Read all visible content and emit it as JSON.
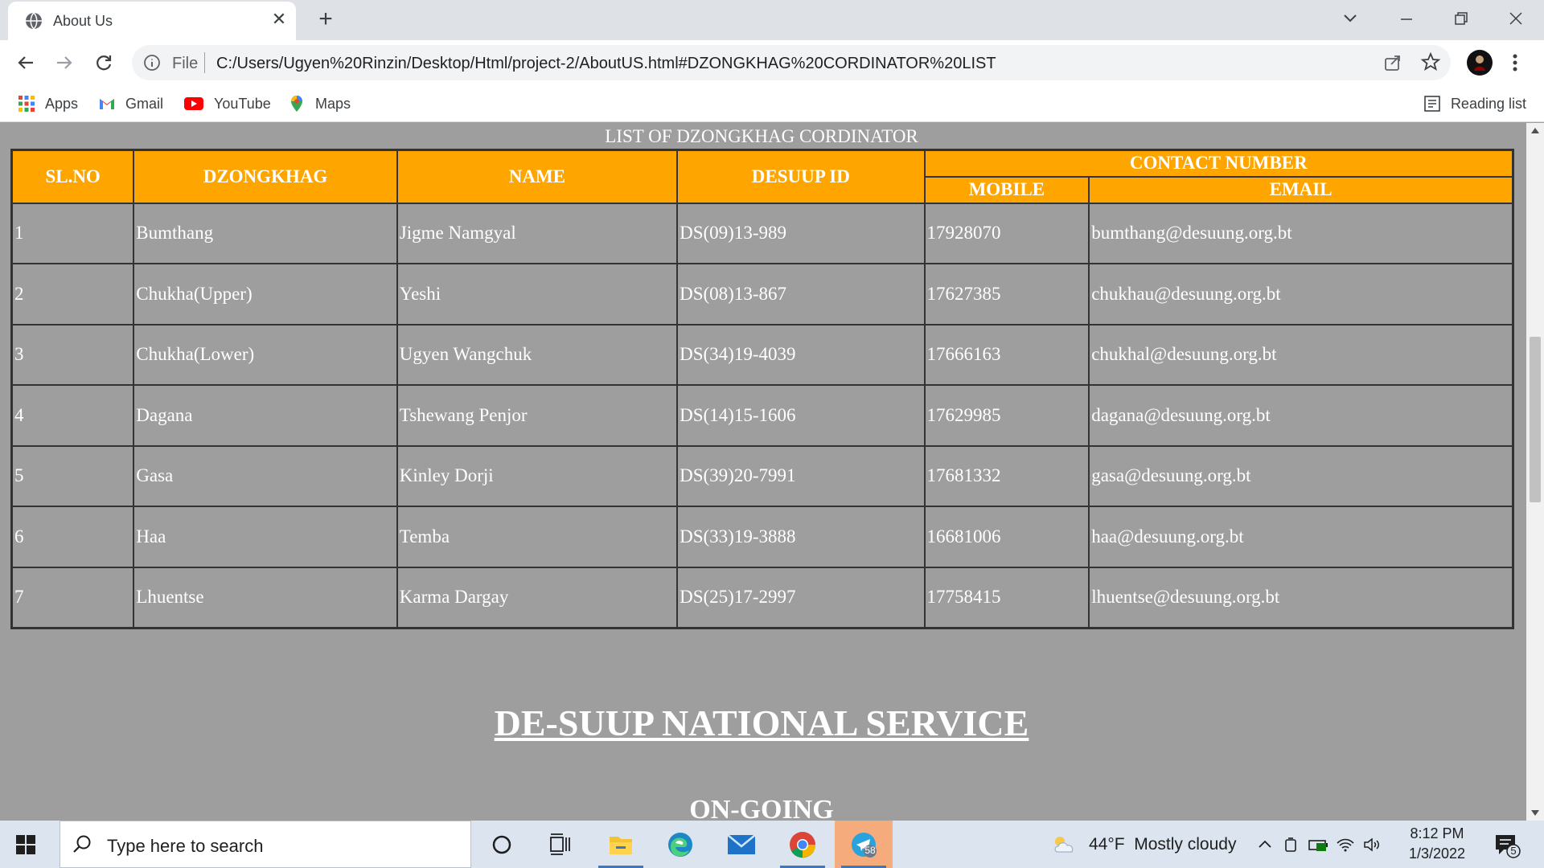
{
  "browser": {
    "tab_title": "About Us",
    "file_label": "File",
    "url": "C:/Users/Ugyen%20Rinzin/Desktop/Html/project-2/AboutUS.html#DZONGKHAG%20CORDINATOR%20LIST",
    "bookmarks": [
      {
        "label": "Apps",
        "icon": "apps-grid-icon"
      },
      {
        "label": "Gmail",
        "icon": "gmail-icon"
      },
      {
        "label": "YouTube",
        "icon": "youtube-icon"
      },
      {
        "label": "Maps",
        "icon": "maps-pin-icon"
      }
    ],
    "reading_list": "Reading list"
  },
  "page": {
    "caption": "LIST OF DZONGKHAG CORDINATOR",
    "headers": {
      "slno": "SL.NO",
      "dzongkhag": "DZONGKHAG",
      "name": "NAME",
      "desuup_id": "DESUUP ID",
      "contact": "CONTACT NUMBER",
      "mobile": "MOBILE",
      "email": "EMAIL"
    },
    "rows": [
      {
        "sl": "1",
        "dzongkhag": "Bumthang",
        "name": "Jigme Namgyal",
        "id": "DS(09)13-989",
        "mobile": "17928070",
        "email": "bumthang@desuung.org.bt"
      },
      {
        "sl": "2",
        "dzongkhag": "Chukha(Upper)",
        "name": "Yeshi",
        "id": "DS(08)13-867",
        "mobile": "17627385",
        "email": "chukhau@desuung.org.bt"
      },
      {
        "sl": "3",
        "dzongkhag": "Chukha(Lower)",
        "name": "Ugyen Wangchuk",
        "id": "DS(34)19-4039",
        "mobile": "17666163",
        "email": "chukhal@desuung.org.bt"
      },
      {
        "sl": "4",
        "dzongkhag": "Dagana",
        "name": "Tshewang Penjor",
        "id": "DS(14)15-1606",
        "mobile": "17629985",
        "email": "dagana@desuung.org.bt"
      },
      {
        "sl": "5",
        "dzongkhag": "Gasa",
        "name": "Kinley Dorji",
        "id": "DS(39)20-7991",
        "mobile": "17681332",
        "email": "gasa@desuung.org.bt"
      },
      {
        "sl": "6",
        "dzongkhag": "Haa",
        "name": "Temba",
        "id": "DS(33)19-3888",
        "mobile": "16681006",
        "email": "haa@desuung.org.bt"
      },
      {
        "sl": "7",
        "dzongkhag": "Lhuentse",
        "name": "Karma Dargay",
        "id": "DS(25)17-2997",
        "mobile": "17758415",
        "email": "lhuentse@desuung.org.bt"
      }
    ],
    "service_heading": "DE-SUUP NATIONAL SERVICE",
    "ongoing_heading": "ON-GOING"
  },
  "taskbar": {
    "search_placeholder": "Type here to search",
    "weather": "44°F  Mostly cloudy",
    "time": "8:12 PM",
    "date": "1/3/2022",
    "telegram_badge": "58",
    "notification_count": "5"
  },
  "colors": {
    "header_bg": "#ffa500",
    "page_bg": "#9e9e9e",
    "accent": "#3b78c2"
  }
}
